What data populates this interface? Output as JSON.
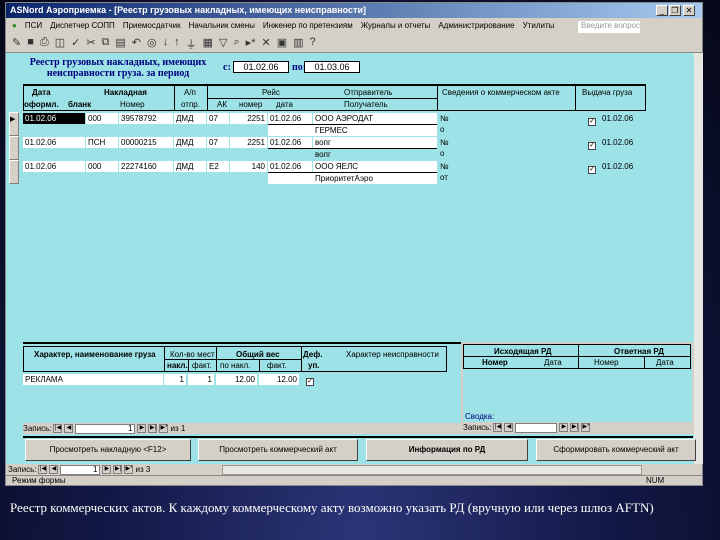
{
  "window": {
    "title": "ASNord Аэроприемка - [Реестр грузовых накладных, имеющих неисправности]",
    "min": "_",
    "max": "❐",
    "close": "✕"
  },
  "menu": [
    "ПСИ",
    "Диспетчер СОПП",
    "Приемосдатчик",
    "Начальник смены",
    "Инженер по претензиям",
    "Журналы и отчеты",
    "Администрирование",
    "Утилиты"
  ],
  "ask_placeholder": "Введите вопрос",
  "toolbar_icons": [
    "design-icon",
    "save-icon",
    "print-icon",
    "preview-icon",
    "spell-icon",
    "cut-icon",
    "copy-icon",
    "paste-icon",
    "undo-icon",
    "hyperlink-icon",
    "sort-asc-icon",
    "sort-desc-icon",
    "filter-icon",
    "filter-form-icon",
    "apply-filter-icon",
    "find-icon",
    "new-record-icon",
    "delete-record-icon",
    "db-window-icon",
    "new-object-icon",
    "help-icon"
  ],
  "form": {
    "title": "Реестр грузовых накладных, имеющих неисправности груза. за период",
    "from_label": "с:",
    "from": "01.02.06",
    "to_label": "по:",
    "to": "01.03.06",
    "headers": {
      "date": "Дата",
      "date2": "оформл.",
      "waybill": "Накладная",
      "blank": "бланк",
      "number": "Номер",
      "ap": "А/п",
      "ap2": "отпр.",
      "flight": "Рейс",
      "ak": "АК",
      "fnum": "номер",
      "fdate": "дата",
      "sender": "Отправитель",
      "receiver": "Получатель",
      "act": "Сведения о коммерческом акте",
      "issue": "Выдача груза"
    },
    "rows": [
      {
        "date": "01.02.06",
        "blank": "000",
        "number": "39578792",
        "ap": "ДМД",
        "ak": "07",
        "fnum": "2251",
        "fdate": "01.02.06",
        "sender": "ООО АЭРОДАТ",
        "receiver": "ГЕРМЕС",
        "act1": "№",
        "act2": "о",
        "issued": true,
        "issue_date": "01.02.06"
      },
      {
        "date": "01.02.06",
        "blank": "ПСН",
        "number": "00000215",
        "ap": "ДМД",
        "ak": "07",
        "fnum": "2251",
        "fdate": "01.02.06",
        "sender": "вопг",
        "receiver": "вопг",
        "act1": "№",
        "act2": "о",
        "issued": true,
        "issue_date": "01.02.06"
      },
      {
        "date": "01.02.06",
        "blank": "000",
        "number": "22274160",
        "ap": "ДМД",
        "ak": "Е2",
        "fnum": "140",
        "fdate": "01.02.06",
        "sender": "ООО ЯЕЛС",
        "receiver": "ПриоритетАэро",
        "act1": "№",
        "act2": "от",
        "issued": true,
        "issue_date": "01.02.06"
      }
    ],
    "cargo": {
      "headers": {
        "nature": "Характер, наименование груза",
        "count": "Кол-во мест",
        "count_w": "накл.",
        "count_f": "факт.",
        "weight": "Общий вес",
        "weight_w": "по накл.",
        "weight_f": "факт.",
        "def": "Деф.",
        "def2": "уп.",
        "fault": "Характер неисправности"
      },
      "rows": [
        {
          "nature": "РЕКЛАМА",
          "count_w": "1",
          "count_f": "1",
          "weight_w": "12.00",
          "weight_f": "12.00",
          "def": true,
          "fault": ""
        }
      ],
      "nav": {
        "label": "Запись:",
        "current": "1",
        "of": "из 1"
      }
    },
    "rd": {
      "headers": {
        "out": "Исходящая РД",
        "out_num": "Номер",
        "out_date": "Дата",
        "in": "Ответная РД",
        "in_num": "Номер",
        "in_date": "Дата"
      },
      "summary": "Сводка:",
      "nav": {
        "label": "Запись:",
        "current": ""
      }
    },
    "buttons": [
      "Просмотреть накладную <F12>",
      "Просмотреть коммерческий акт",
      "Информация по РД",
      "Сформировать коммерческий акт"
    ],
    "nav": {
      "label": "Запись:",
      "current": "1",
      "of": "из 3"
    }
  },
  "status": {
    "text": "Режим формы",
    "num": "NUM"
  },
  "caption": "Реестр коммерческих актов. К каждому коммерческому акту возможно указать РД (вручную или через шлюз AFTN)"
}
